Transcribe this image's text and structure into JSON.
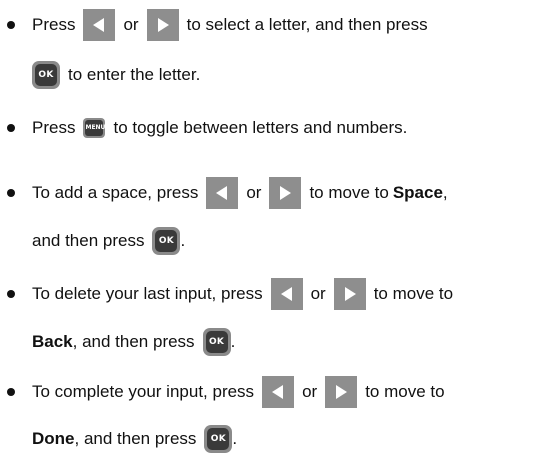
{
  "items": [
    {
      "line1": {
        "t0": "Press",
        "t1": "or",
        "t2": "to select a letter, and then press"
      },
      "line2": {
        "t0": "to enter the letter."
      }
    },
    {
      "line1": {
        "t0": "Press",
        "t1": "to toggle between letters and numbers."
      }
    },
    {
      "line1": {
        "t0": "To add a space, press",
        "t1": "or",
        "t2": "to move to",
        "bold": "Space",
        "t3": ","
      },
      "line2": {
        "t0": "and then press",
        "t1": "."
      }
    },
    {
      "line1": {
        "t0": "To delete your last input, press",
        "t1": "or",
        "t2": "to move to"
      },
      "line2": {
        "bold": "Back",
        "t0": ", and then press",
        "t1": "."
      }
    },
    {
      "line1": {
        "t0": "To complete your input, press",
        "t1": "or",
        "t2": "to move to"
      },
      "line2": {
        "bold": "Done",
        "t0": ", and then press",
        "t1": "."
      }
    }
  ],
  "keys": {
    "ok_label": "OK",
    "menu_label": "MENU",
    "left_arrow_icon": "left-arrow-icon",
    "right_arrow_icon": "right-arrow-icon"
  },
  "colors": {
    "text": "#111111",
    "arrow_button_bg": "#8e8e8e",
    "arrow_glyph": "#ffffff",
    "key_body": "#3a3a3a",
    "key_border": "#8a8a8a"
  }
}
